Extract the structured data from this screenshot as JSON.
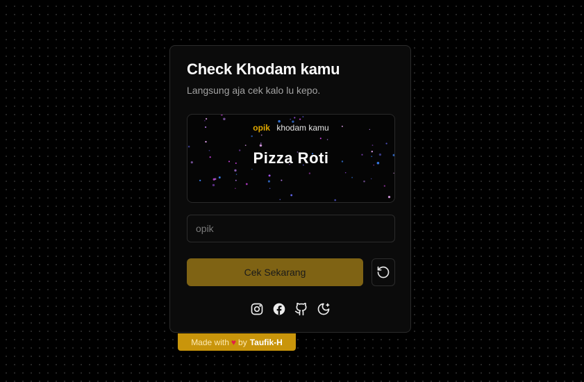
{
  "colors": {
    "accent": "#e0a800",
    "button_bg": "#7f6314",
    "badge_bg": "#c9950b",
    "heart": "#e11d48"
  },
  "card": {
    "title": "Check Khodam kamu",
    "subtitle": "Langsung aja cek kalo lu kepo."
  },
  "result": {
    "name": "opik",
    "label": "khodam kamu",
    "khodam": "Pizza Roti"
  },
  "form": {
    "input_value": "",
    "input_placeholder": "opik",
    "submit_label": "Cek Sekarang",
    "reset_icon": "reset-icon"
  },
  "socials": [
    {
      "icon": "instagram-icon"
    },
    {
      "icon": "facebook-icon"
    },
    {
      "icon": "github-icon"
    },
    {
      "icon": "moon-stars-icon"
    }
  ],
  "footer": {
    "made_with": "Made with",
    "heart": "♥",
    "by": "by",
    "author": "Taufik-H"
  }
}
